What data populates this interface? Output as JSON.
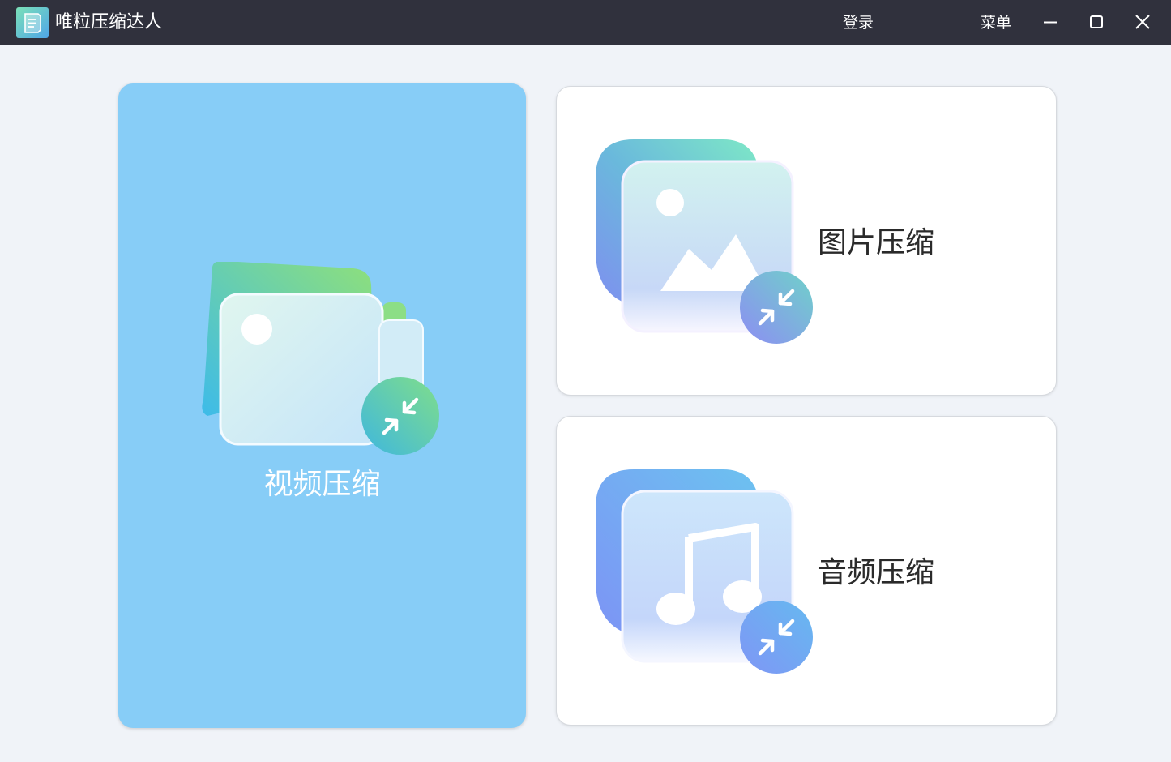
{
  "app": {
    "title": "唯粒压缩达人",
    "logo_icon": "document-logo-icon"
  },
  "titlebar": {
    "login_label": "登录",
    "menu_label": "菜单",
    "minimize_icon": "minimize-icon",
    "maximize_icon": "maximize-icon",
    "close_icon": "close-icon"
  },
  "cards": {
    "video": {
      "label": "视频压缩",
      "icon": "video-folder-icon",
      "badge_icon": "compress-arrows-icon"
    },
    "image": {
      "label": "图片压缩",
      "icon": "image-icon",
      "badge_icon": "compress-arrows-icon"
    },
    "audio": {
      "label": "音频压缩",
      "icon": "music-note-icon",
      "badge_icon": "compress-arrows-icon"
    }
  },
  "colors": {
    "titlebar_bg": "#30313d",
    "page_bg": "#f0f3f8",
    "video_card_bg": "#87cdf7",
    "card_bg": "#ffffff",
    "label_dark": "#2a2a2a"
  }
}
